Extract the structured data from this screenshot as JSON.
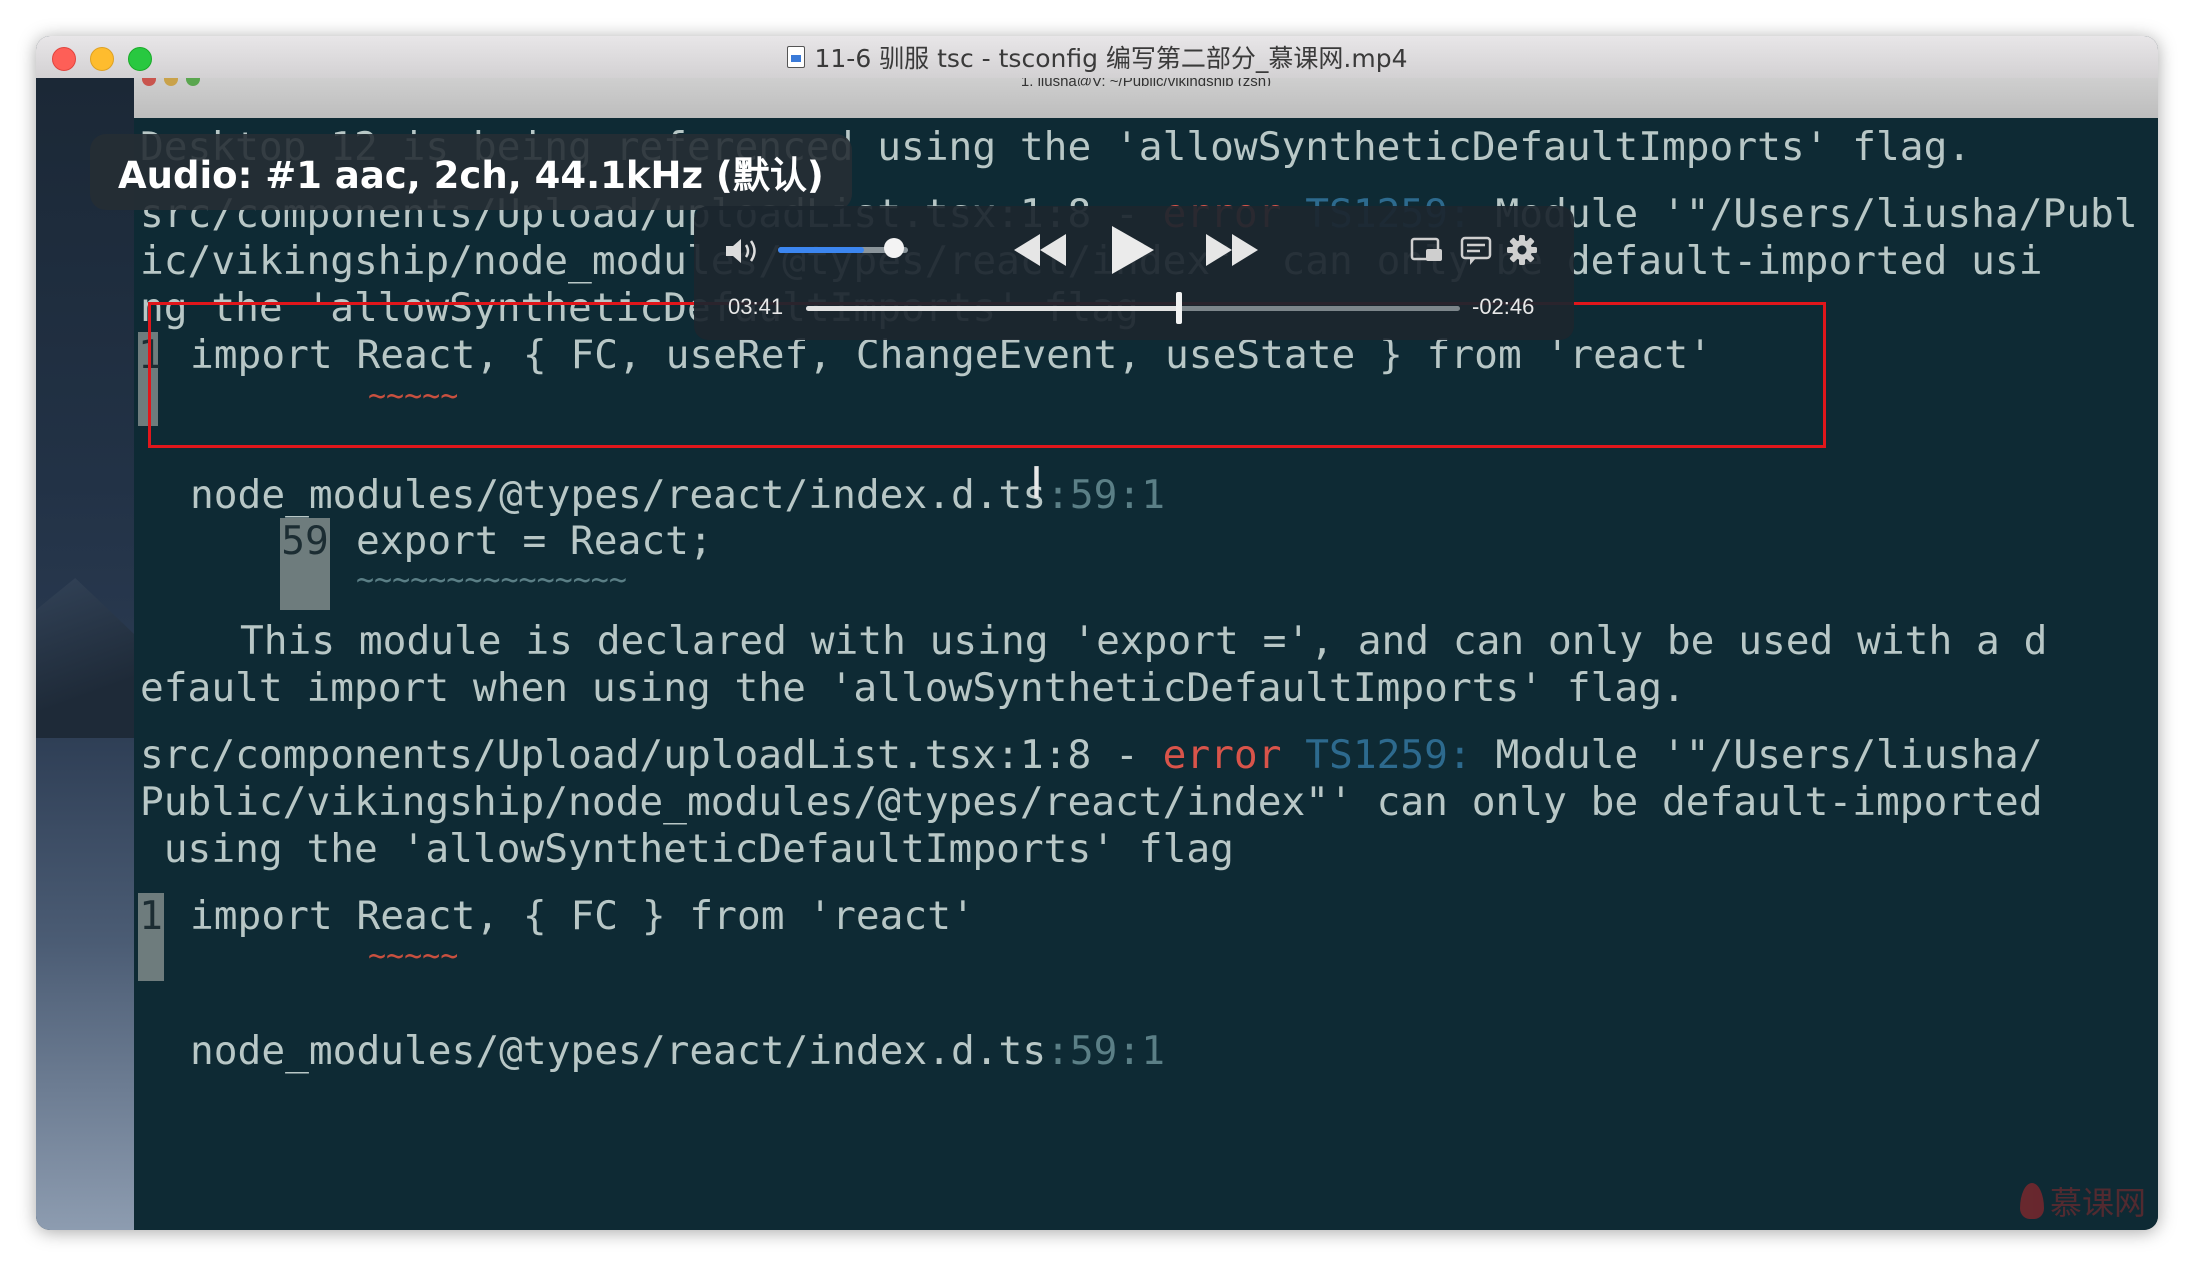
{
  "window": {
    "title": "11-6 驯服 tsc - tsconfig 编写第二部分_慕课网.mp4",
    "inner_title": "1. liusha@V: ~/Public/vikingship (zsh)"
  },
  "overlay": {
    "audio_info": "Audio: #1 aac, 2ch, 44.1kHz (默认)"
  },
  "player": {
    "elapsed": "03:41",
    "remaining": "-02:46",
    "progress": 0.57,
    "volume": 0.66
  },
  "terminal": {
    "l1_text": "Desktop 12 is being referenced using the 'allowSyntheticDefaultImports' flag.",
    "l2_path": "src/components/Upload/uploadList.tsx",
    "l2_loc": ":1:8",
    "l2_dash": " - ",
    "l2_error": "error",
    "l2_code": "TS1259:",
    "l2_msg": " Module '\"/Users/liusha/Publ",
    "l3": "ic/vikingship/node_modules/@types/react/index\"' can only be default-imported usi",
    "l4": "ng the 'allowSyntheticDefaultImports' flag",
    "g1_num": "1",
    "l5": "import React, { FC, useRef, ChangeEvent, useState } from 'react'",
    "l6_squiggle": "~~~~~",
    "l7_path": "node_modules/@types/react/index.d.ts",
    "l7_loc": ":59:1",
    "g2_num": "59",
    "l8": "export = React;",
    "l9_squiggle": "~~~~~~~~~~~~~~~",
    "l10": "This module is declared with using 'export =', and can only be used with a d",
    "l11": "efault import when using the 'allowSyntheticDefaultImports' flag.",
    "l12_path": "src/components/Upload/uploadList.tsx",
    "l12_loc": ":1:8",
    "l12_dash": " - ",
    "l12_error": "error",
    "l12_code": "TS1259:",
    "l12_msg": " Module '\"/Users/liusha/",
    "l13": "Public/vikingship/node_modules/@types/react/index\"' can only be default-imported",
    "l14": " using the 'allowSyntheticDefaultImports' flag",
    "g3_num": "1",
    "l15": "import React, { FC } from 'react'",
    "l16_squiggle": "~~~~~",
    "l17_path": "node_modules/@types/react/index.d.ts",
    "l17_loc": ":59:1"
  },
  "watermark": {
    "text": "慕课网"
  },
  "colors": {
    "terminal_bg": "#0e2a34",
    "text": "#b8c7c6",
    "error": "#d9544a",
    "error_code": "#2d6a8e",
    "highlight_box": "#e0161b",
    "volume_accent": "#3c86f0"
  },
  "icons": [
    "document-icon",
    "volume-icon",
    "rewind-icon",
    "play-icon",
    "fast-forward-icon",
    "picture-in-picture-icon",
    "subtitles-icon",
    "settings-gear-icon",
    "text-cursor-icon",
    "flame-logo-icon"
  ]
}
